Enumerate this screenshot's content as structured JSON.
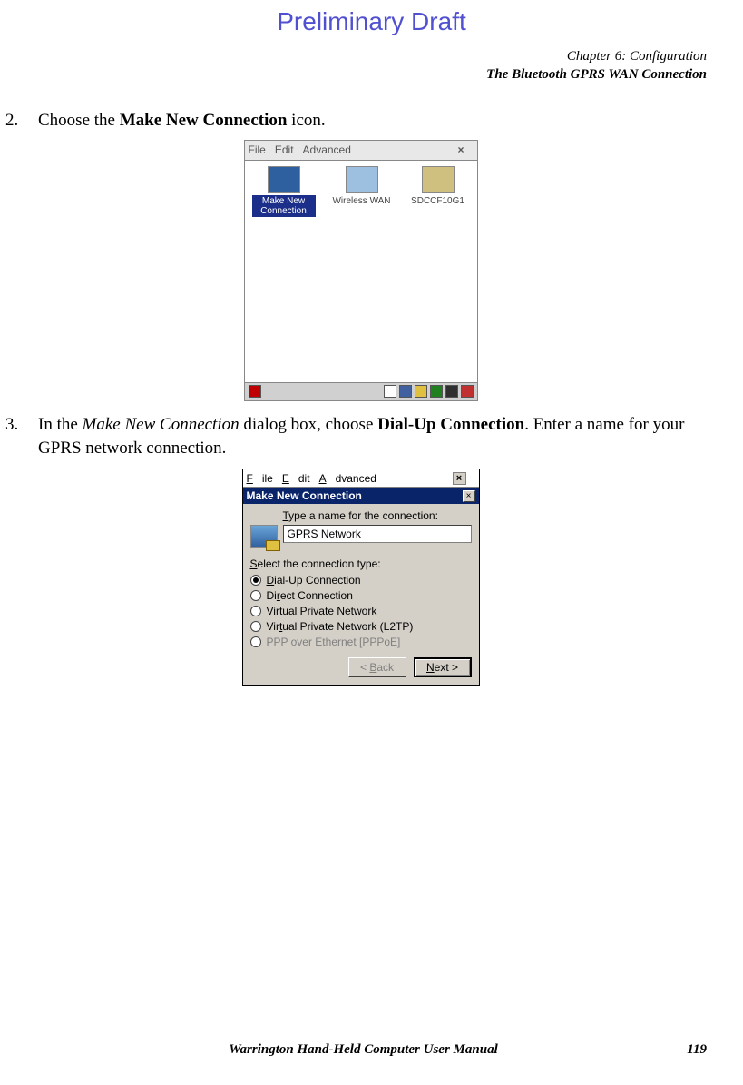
{
  "draft_header": "Preliminary Draft",
  "chapter": {
    "line1": "Chapter 6: Configuration",
    "line2": "The Bluetooth GPRS WAN Connection"
  },
  "steps": {
    "s2": {
      "num": "2.",
      "pre": "Choose the ",
      "bold": "Make New Connection",
      "post": " icon."
    },
    "s3": {
      "num": "3.",
      "pre": "In the ",
      "ital": "Make New Connection",
      "mid": " dialog box, choose ",
      "bold": "Dial-Up Connection",
      "post": ". Enter a name for your GPRS network connection."
    }
  },
  "shot1": {
    "menu": {
      "file": "File",
      "edit": "Edit",
      "adv": "Advanced",
      "close": "×"
    },
    "icons": {
      "a": "Make New Connection",
      "b": "Wireless WAN",
      "c": "SDCCF10G1"
    }
  },
  "shot2": {
    "menu": {
      "file": "File",
      "edit": "Edit",
      "adv": "Advanced",
      "close": "×"
    },
    "title": "Make New Connection",
    "prompt1": "Type a name for the connection:",
    "input_value": "GPRS Network",
    "prompt2": "Select the connection type:",
    "opts": {
      "dial": "Dial-Up Connection",
      "direct": "Direct Connection",
      "vpn": "Virtual Private Network",
      "l2tp": "Virtual Private Network (L2TP)",
      "pppoe": "PPP over Ethernet [PPPoE]"
    },
    "buttons": {
      "back": "< Back",
      "next": "Next >"
    }
  },
  "footer": {
    "title": "Warrington Hand-Held Computer User Manual",
    "page": "119"
  }
}
